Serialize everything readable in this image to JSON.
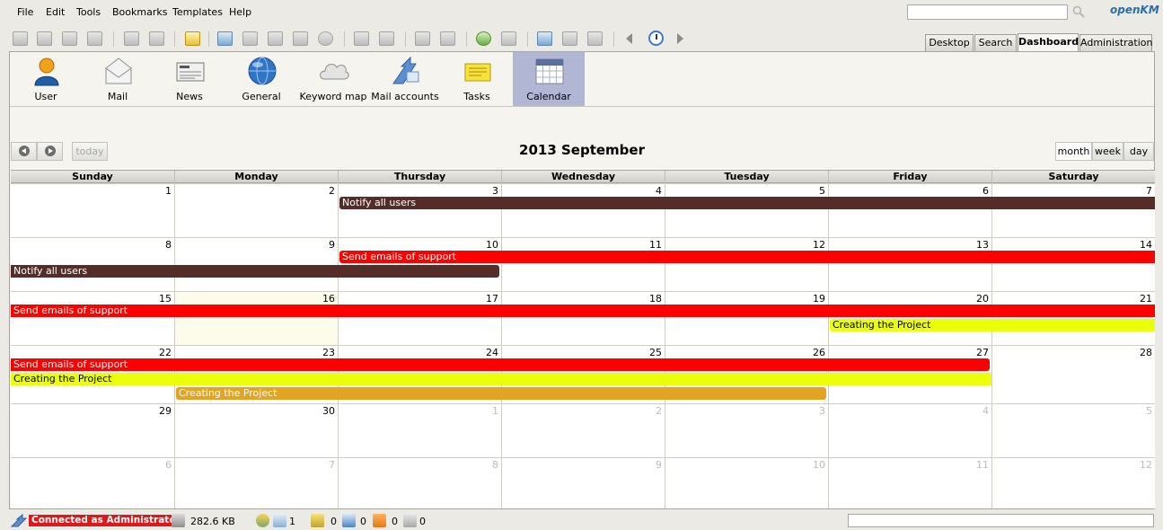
{
  "menu": [
    "File",
    "Edit",
    "Tools",
    "Bookmarks",
    "Templates",
    "Help"
  ],
  "search": {
    "placeholder": ""
  },
  "logo": {
    "main": "openKM"
  },
  "workspace_tabs": [
    "Desktop",
    "Search",
    "Dashboard",
    "Administration"
  ],
  "active_workspace_tab": "Dashboard",
  "dashboard_tabs": [
    "User",
    "Mail",
    "News",
    "General",
    "Keyword map",
    "Mail accounts",
    "Tasks",
    "Calendar"
  ],
  "active_dashboard_tab": "Calendar",
  "calendar": {
    "title": "2013 September",
    "today_label": "today",
    "view_buttons": [
      "month",
      "week",
      "day"
    ],
    "active_view": "month",
    "day_headers": [
      "Sunday",
      "Monday",
      "Thursday",
      "Wednesday",
      "Tuesday",
      "Friday",
      "Saturday"
    ],
    "weeks": [
      [
        "1",
        "2",
        "3",
        "4",
        "5",
        "6",
        "7"
      ],
      [
        "8",
        "9",
        "10",
        "11",
        "12",
        "13",
        "14"
      ],
      [
        "15",
        "16",
        "17",
        "18",
        "19",
        "20",
        "21"
      ],
      [
        "22",
        "23",
        "24",
        "25",
        "26",
        "27",
        "28"
      ],
      [
        "29",
        "30",
        "1",
        "2",
        "3",
        "4",
        "5"
      ],
      [
        "6",
        "7",
        "8",
        "9",
        "10",
        "11",
        "12"
      ]
    ],
    "events": [
      {
        "title": "Notify all users",
        "color": "#542d28",
        "text_color": "#ffffff"
      },
      {
        "title": "Notify all users",
        "color": "#542d28",
        "text_color": "#ffffff"
      },
      {
        "title": "Send emails of support",
        "color": "#ff0000",
        "text_color": "#ffffff"
      },
      {
        "title": "Send emails of support",
        "color": "#ff0000",
        "text_color": "#ffffff"
      },
      {
        "title": "Creating the Project",
        "color": "#ecff0a",
        "text_color": "#000000"
      },
      {
        "title": "Send emails of support",
        "color": "#ff0000",
        "text_color": "#ffffff"
      },
      {
        "title": "Creating the Project",
        "color": "#ecff0a",
        "text_color": "#000000"
      },
      {
        "title": "Creating the Project",
        "color": "#e2a422",
        "text_color": "#ffffff"
      }
    ]
  },
  "status": {
    "connected": "Connected as Administrator",
    "size": "282.6 KB",
    "users_count": "1",
    "locked_count": "0",
    "checkout_count": "0",
    "mail_count": "0",
    "subscription_count": "0"
  }
}
